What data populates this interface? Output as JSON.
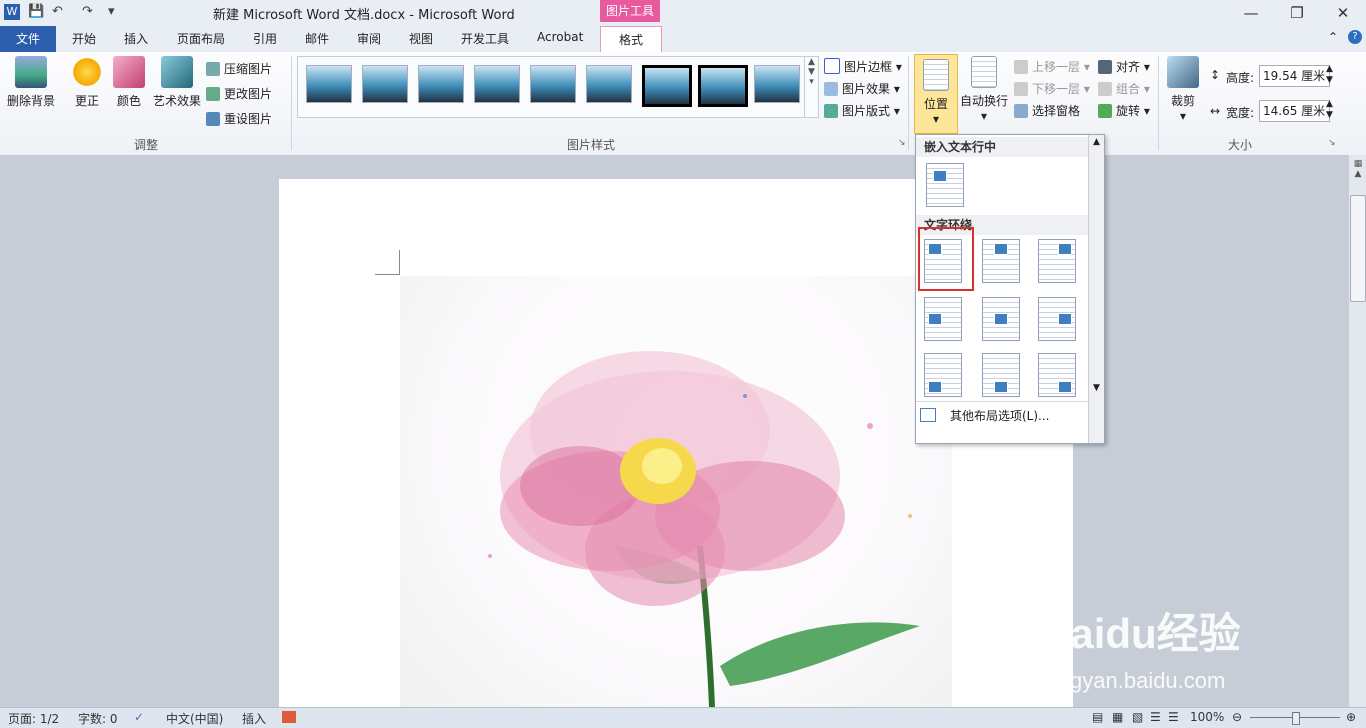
{
  "titlebar": {
    "title": "新建 Microsoft Word 文档.docx - Microsoft Word",
    "context_tab": "图片工具",
    "quick_access": [
      "save-icon",
      "undo-icon",
      "redo-icon",
      "customize-icon"
    ]
  },
  "tabs": {
    "file": "文件",
    "items": [
      "开始",
      "插入",
      "页面布局",
      "引用",
      "邮件",
      "审阅",
      "视图",
      "开发工具",
      "Acrobat"
    ],
    "active": "格式"
  },
  "ribbon": {
    "adjust": {
      "label": "调整",
      "remove_bg": "删除背景",
      "correct": "更正",
      "color": "颜色",
      "artistic": "艺术效果",
      "compress": "压缩图片",
      "change": "更改图片",
      "reset": "重设图片"
    },
    "styles": {
      "label": "图片样式",
      "border": "图片边框",
      "effects": "图片效果",
      "layout": "图片版式"
    },
    "arrange": {
      "position": "位置",
      "wrap": "自动换行",
      "forward": "上移一层",
      "backward": "下移一层",
      "selection_pane": "选择窗格",
      "align": "对齐",
      "group": "组合",
      "rotate": "旋转"
    },
    "size": {
      "label": "大小",
      "crop": "裁剪",
      "height_label": "高度:",
      "height_value": "19.54 厘米",
      "width_label": "宽度:",
      "width_value": "14.65 厘米"
    }
  },
  "dropdown": {
    "inline_header": "嵌入文本行中",
    "wrap_header": "文字环绕",
    "more_options": "其他布局选项(L)..."
  },
  "statusbar": {
    "page": "页面: 1/2",
    "words": "字数: 0",
    "language": "中文(中国)",
    "insert_mode": "插入",
    "zoom": "100%"
  },
  "watermark": {
    "brand": "Baidu经验",
    "url": "jingyan.baidu.com"
  },
  "colors": {
    "file_tab": "#2b5fad",
    "context_tab": "#e85a9e",
    "highlight": "#d9302b"
  }
}
